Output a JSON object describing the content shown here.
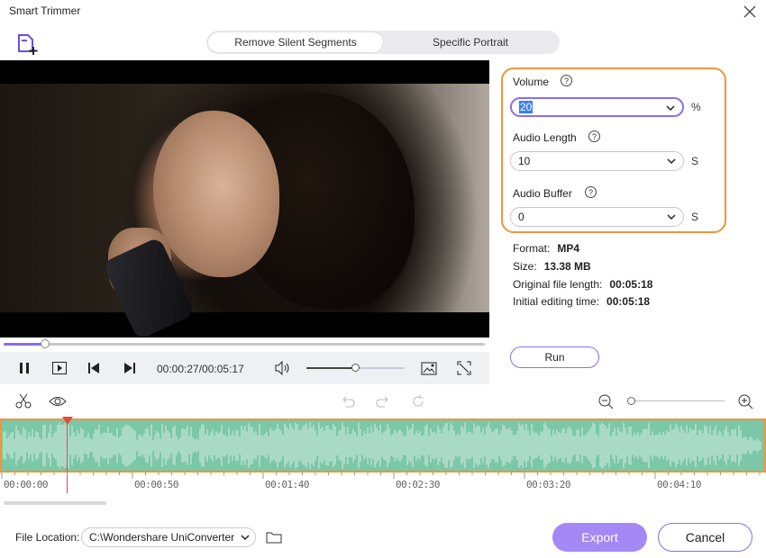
{
  "window": {
    "title": "Smart Trimmer"
  },
  "icons": {
    "close": "close-icon",
    "add_file": "add-file-icon",
    "pause": "pause-icon",
    "play": "play-icon",
    "prev": "previous-icon",
    "next": "next-icon",
    "volume": "volume-icon",
    "snapshot": "snapshot-icon",
    "fullscreen": "fullscreen-icon",
    "cut": "scissors-icon",
    "preview": "eye-icon",
    "undo": "undo-icon",
    "redo": "redo-icon",
    "reset": "refresh-icon",
    "zoom_out": "zoom-out-icon",
    "zoom_in": "zoom-in-icon",
    "folder": "folder-icon"
  },
  "tabs": [
    {
      "label": "Remove Silent Segments",
      "active": true
    },
    {
      "label": "Specific Portrait",
      "active": false
    }
  ],
  "player": {
    "current_time": "00:00:27",
    "total_time": "00:05:17",
    "time_display": "00:00:27/00:05:17",
    "progress_fraction": 0.087,
    "volume_fraction": 0.5
  },
  "settings": {
    "volume": {
      "label": "Volume",
      "help": "?",
      "value": "20",
      "unit": "%"
    },
    "audio_length": {
      "label": "Audio Length",
      "help": "?",
      "value": "10",
      "unit": "S"
    },
    "audio_buffer": {
      "label": "Audio Buffer",
      "help": "?",
      "value": "0",
      "unit": "S"
    }
  },
  "file_info": {
    "format_label": "Format:",
    "format_value": "MP4",
    "size_label": "Size:",
    "size_value": "13.38 MB",
    "orig_label": "Original file length:",
    "orig_value": "00:05:18",
    "edit_label": "Initial editing time:",
    "edit_value": "00:05:18"
  },
  "run_label": "Run",
  "timeline": {
    "ticks": [
      "00:00:00",
      "00:00:50",
      "00:01:40",
      "00:02:30",
      "00:03:20",
      "00:04:10"
    ],
    "zoom_fraction": 0.0
  },
  "footer": {
    "file_location_label": "File Location:",
    "file_location_value": "C:\\Wondershare UniConverter",
    "export_label": "Export",
    "cancel_label": "Cancel"
  },
  "colors": {
    "accent": "#8a6cf3",
    "highlight_border": "#f0953a",
    "waveform_bg": "#7cc7a8",
    "playhead": "#e84b3c"
  }
}
